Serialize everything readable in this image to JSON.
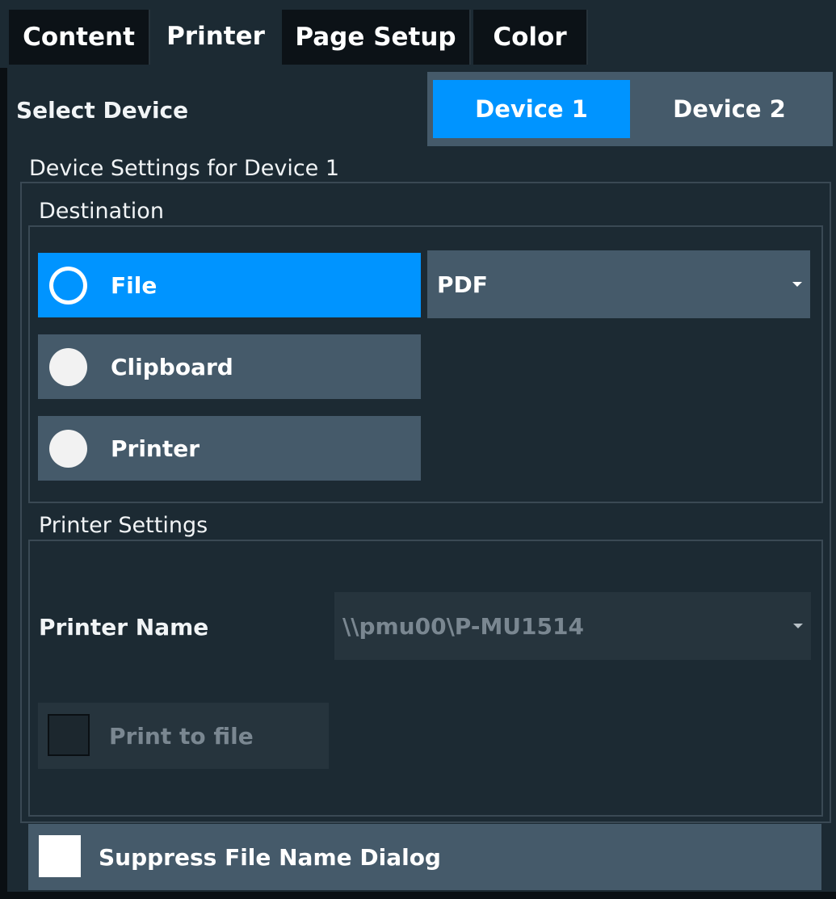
{
  "tabs": [
    {
      "label": "Content",
      "active": false
    },
    {
      "label": "Printer",
      "active": true
    },
    {
      "label": "Page Setup",
      "active": false
    },
    {
      "label": "Color",
      "active": false
    }
  ],
  "select_device": {
    "label": "Select Device",
    "options": [
      "Device 1",
      "Device 2"
    ],
    "selected": "Device 1"
  },
  "device_settings": {
    "title": "Device Settings for Device 1",
    "destination": {
      "title": "Destination",
      "options": [
        {
          "label": "File",
          "selected": true
        },
        {
          "label": "Clipboard",
          "selected": false
        },
        {
          "label": "Printer",
          "selected": false
        }
      ],
      "file_format": "PDF"
    },
    "printer_settings": {
      "title": "Printer Settings",
      "printer_name_label": "Printer Name",
      "printer_name_value": "\\\\pmu00\\P-MU1514",
      "print_to_file_label": "Print to file",
      "print_to_file_checked": false
    }
  },
  "suppress_dialog": {
    "label": "Suppress File Name Dialog",
    "checked": false
  },
  "colors": {
    "accent": "#0094ff",
    "panel": "#1c2a33",
    "button": "#455a6a"
  }
}
